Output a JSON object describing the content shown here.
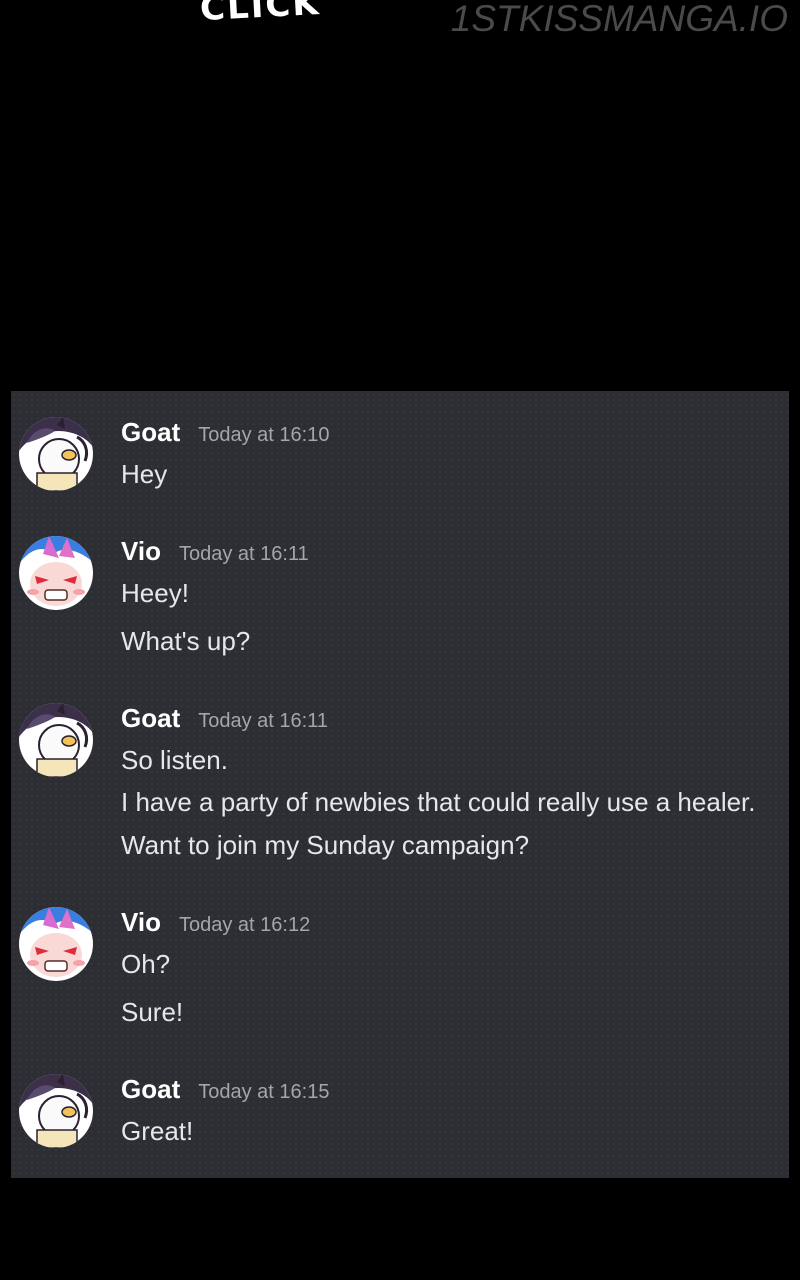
{
  "sfx_text": "CLICK",
  "watermark": "1STKISSMANGA.IO",
  "messages": [
    {
      "user": "Goat",
      "avatar": "goat-avatar",
      "time": "Today at 16:10",
      "lines": [
        "Hey"
      ]
    },
    {
      "user": "Vio",
      "avatar": "vio-avatar",
      "time": "Today at 16:11",
      "lines": [
        "Heey!",
        "What's up?"
      ]
    },
    {
      "user": "Goat",
      "avatar": "goat-avatar",
      "time": "Today at 16:11",
      "lines": [
        "So listen.",
        "I have a party of newbies that could really use a healer.",
        "Want to join my Sunday campaign?"
      ]
    },
    {
      "user": "Vio",
      "avatar": "vio-avatar",
      "time": "Today at 16:12",
      "lines": [
        "Oh?",
        "Sure!"
      ]
    },
    {
      "user": "Goat",
      "avatar": "goat-avatar",
      "time": "Today at 16:15",
      "lines": [
        "Great!"
      ]
    }
  ],
  "colors": {
    "page_bg": "#000000",
    "chat_bg": "#2c2e33",
    "username": "#ffffff",
    "timestamp": "#a3a6ab",
    "message_text": "#e6e7e9"
  }
}
